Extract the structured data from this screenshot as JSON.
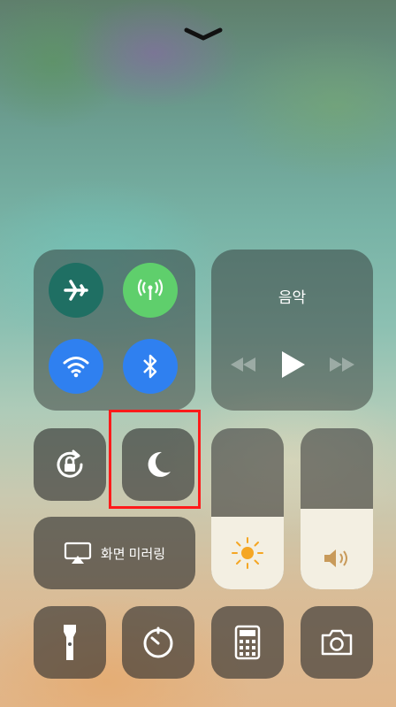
{
  "control_center": {
    "media": {
      "title": "음악"
    },
    "screen_mirroring": {
      "label": "화면 미러링"
    },
    "connectivity": {
      "airplane_color": "#1f6f63",
      "cellular_color": "#5fcf6c",
      "wifi_color": "#2f80f0",
      "bluetooth_color": "#2f80f0"
    },
    "brightness": {
      "level": 0.45
    },
    "volume": {
      "level": 0.5
    },
    "icons": [
      "chevron-down-icon",
      "airplane-icon",
      "cellular-antenna-icon",
      "wifi-icon",
      "bluetooth-icon",
      "rewind-icon",
      "play-icon",
      "fast-forward-icon",
      "rotation-lock-icon",
      "do-not-disturb-moon-icon",
      "airplay-icon",
      "sun-icon",
      "speaker-icon",
      "flashlight-icon",
      "timer-icon",
      "calculator-icon",
      "camera-icon"
    ],
    "highlight_color": "#ff1a1a"
  }
}
